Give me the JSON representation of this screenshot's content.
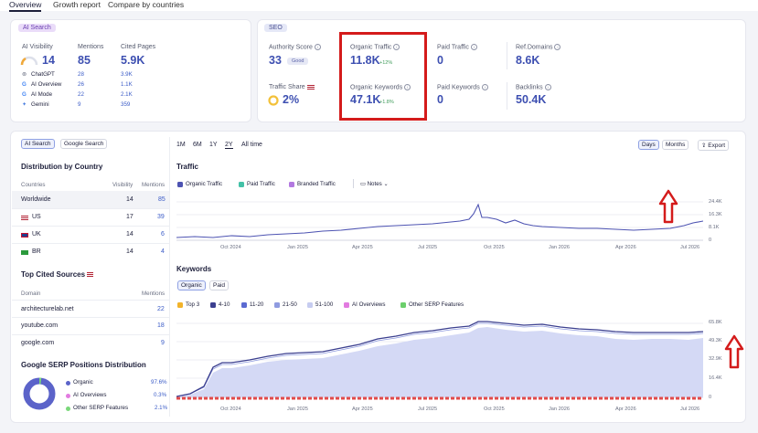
{
  "tabs": [
    "Overview",
    "Growth report",
    "Compare by countries"
  ],
  "ai_search": {
    "badge": "AI Search",
    "visibility_label": "AI Visibility",
    "visibility_value": "14",
    "mentions_label": "Mentions",
    "mentions_value": "85",
    "cited_label": "Cited Pages",
    "cited_value": "5.9K",
    "rows": [
      {
        "name": "ChatGPT",
        "visibility": "28",
        "cited": "3.9K"
      },
      {
        "name": "AI Overview",
        "visibility": "26",
        "cited": "1.1K"
      },
      {
        "name": "AI Mode",
        "visibility": "22",
        "cited": "2.1K"
      },
      {
        "name": "Gemini",
        "visibility": "9",
        "cited": "359"
      }
    ]
  },
  "seo": {
    "badge": "SEO",
    "authority_label": "Authority Score",
    "authority_value": "33",
    "authority_badge": "Good",
    "organic_traffic_label": "Organic Traffic",
    "organic_traffic_value": "11.8K",
    "organic_traffic_change": "+12%",
    "paid_traffic_label": "Paid Traffic",
    "paid_traffic_value": "0",
    "ref_domains_label": "Ref.Domains",
    "ref_domains_value": "8.6K",
    "traffic_share_label": "Traffic Share",
    "traffic_share_value": "2%",
    "organic_keywords_label": "Organic Keywords",
    "organic_keywords_value": "47.1K",
    "organic_keywords_change": "+1.8%",
    "paid_keywords_label": "Paid Keywords",
    "paid_keywords_value": "0",
    "backlinks_label": "Backlinks",
    "backlinks_value": "50.4K"
  },
  "left_panel": {
    "toggle": [
      "AI Search",
      "Google Search"
    ],
    "distribution_title": "Distribution by Country",
    "dist_headers": [
      "Countries",
      "Visibility",
      "Mentions"
    ],
    "dist_rows": [
      {
        "country": "Worldwide",
        "visibility": "14",
        "mentions": "85"
      },
      {
        "country": "US",
        "visibility": "17",
        "mentions": "39"
      },
      {
        "country": "UK",
        "visibility": "14",
        "mentions": "6"
      },
      {
        "country": "BR",
        "visibility": "14",
        "mentions": "4"
      }
    ],
    "cited_title": "Top Cited Sources",
    "cited_headers": [
      "Domain",
      "Mentions"
    ],
    "cited_rows": [
      {
        "domain": "architecturelab.net",
        "mentions": "22"
      },
      {
        "domain": "youtube.com",
        "mentions": "18"
      },
      {
        "domain": "google.com",
        "mentions": "9"
      }
    ],
    "serp_title": "Google SERP Positions Distribution",
    "serp_rows": [
      {
        "name": "Organic",
        "value": "97.6%",
        "pct": 97.6,
        "color": "#5b63c9"
      },
      {
        "name": "AI Overviews",
        "value": "0.3%",
        "pct": 0.3,
        "color": "#e27be0"
      },
      {
        "name": "Other SERP Features",
        "value": "2.1%",
        "pct": 2.1,
        "color": "#7ad87a"
      }
    ]
  },
  "traffic": {
    "periods": [
      "1M",
      "6M",
      "1Y",
      "2Y",
      "All time"
    ],
    "selected_period": "2Y",
    "view": [
      "Days",
      "Months"
    ],
    "export": "Export",
    "title": "Traffic",
    "legend": [
      "Organic Traffic",
      "Paid Traffic",
      "Branded Traffic"
    ],
    "notes": "Notes",
    "y_ticks": [
      "24.4K",
      "16.3K",
      "8.1K",
      "0"
    ],
    "x_ticks": [
      "Oct 2024",
      "Jan 2025",
      "Apr 2025",
      "Jul 2025",
      "Oct 2025",
      "Jan 2026",
      "Apr 2026",
      "Jul 2026"
    ]
  },
  "keywords": {
    "title": "Keywords",
    "toggle": [
      "Organic",
      "Paid"
    ],
    "legend": [
      "Top 3",
      "4-10",
      "11-20",
      "21-50",
      "51-100",
      "AI Overviews",
      "Other SERP Features"
    ],
    "legend_colors": [
      "#f2b32a",
      "#3b3f8f",
      "#5b6ad1",
      "#8f9be0",
      "#c6ccf0",
      "#e27be0",
      "#6ccf6c"
    ],
    "y_ticks": [
      "65.8K",
      "49.3K",
      "32.9K",
      "16.4K",
      "0"
    ],
    "x_ticks": [
      "Oct 2024",
      "Jan 2025",
      "Apr 2025",
      "Jul 2025",
      "Oct 2025",
      "Jan 2026",
      "Apr 2026",
      "Jul 2026"
    ]
  },
  "colors": {
    "highlight": "#d41b1b",
    "accent": "#3d4fb1",
    "arrow": "#d41b1b"
  }
}
